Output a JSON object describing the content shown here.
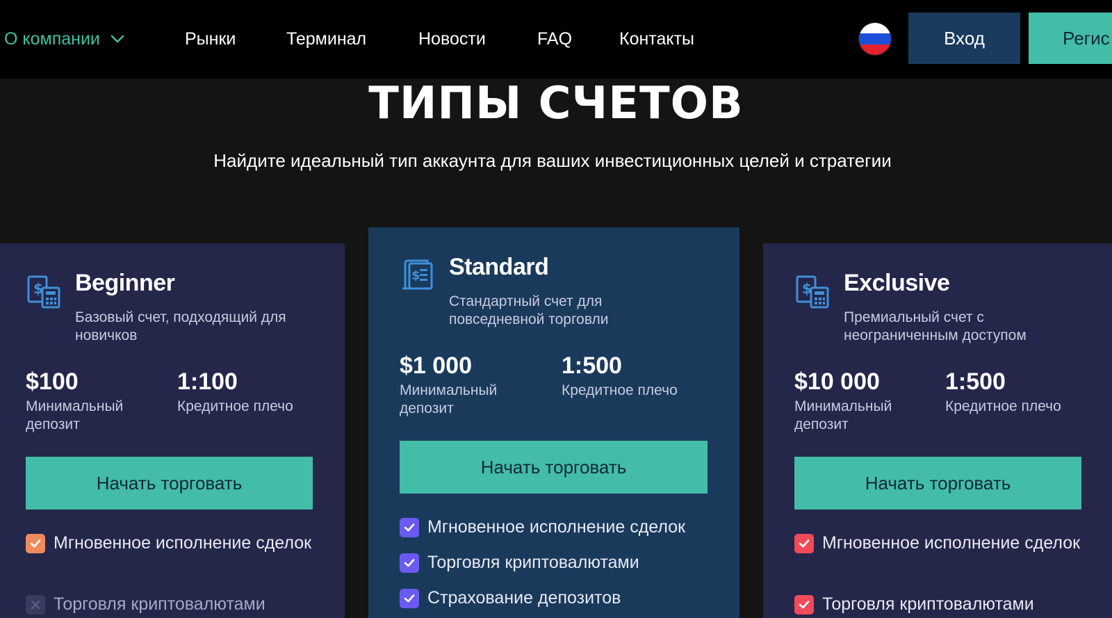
{
  "nav": {
    "about": "О компании",
    "markets": "Рынки",
    "terminal": "Терминал",
    "news": "Новости",
    "faq": "FAQ",
    "contacts": "Контакты",
    "login": "Вход",
    "register": "Регис",
    "language_icon": "russia-flag-icon"
  },
  "header": {
    "title": "ТИПЫ СЧЕТОВ",
    "subtitle": "Найдите идеальный тип аккаунта для ваших инвестиционных целей и стратегии"
  },
  "accounts": [
    {
      "name": "Beginner",
      "description": "Базовый счет, подходящий для новичков",
      "deposit_value": "$100",
      "deposit_label": "Минимальный депозит",
      "leverage_value": "1:100",
      "leverage_label": "Кредитное плечо",
      "cta": "Начать торговать",
      "features": [
        {
          "label": "Мгновенное исполнение сделок",
          "included": true
        },
        {
          "label": "Торговля криптовалютами",
          "included": false
        }
      ]
    },
    {
      "name": "Standard",
      "description": "Стандартный счет для повседневной торговли",
      "deposit_value": "$1 000",
      "deposit_label": "Минимальный депозит",
      "leverage_value": "1:500",
      "leverage_label": "Кредитное плечо",
      "cta": "Начать торговать",
      "features": [
        {
          "label": "Мгновенное исполнение сделок",
          "included": true
        },
        {
          "label": "Торговля криптовалютами",
          "included": true
        },
        {
          "label": "Страхование депозитов",
          "included": true
        }
      ]
    },
    {
      "name": "Exclusive",
      "description": "Премиальный счет с неограниченным доступом",
      "deposit_value": "$10 000",
      "deposit_label": "Минимальный депозит",
      "leverage_value": "1:500",
      "leverage_label": "Кредитное плечо",
      "cta": "Начать торговать",
      "features": [
        {
          "label": "Мгновенное исполнение сделок",
          "included": true
        },
        {
          "label": "Торговля криптовалютами",
          "included": true
        }
      ]
    }
  ],
  "colors": {
    "accent": "#43bca8",
    "nav_active": "#3fbfa3",
    "login_bg": "#1a3a5e",
    "card_bg": "#24264a",
    "card_featured_bg": "#1a3a5c",
    "check_beginner": "#f08a5d",
    "check_standard": "#6a5af0",
    "check_exclusive": "#f04b58"
  }
}
